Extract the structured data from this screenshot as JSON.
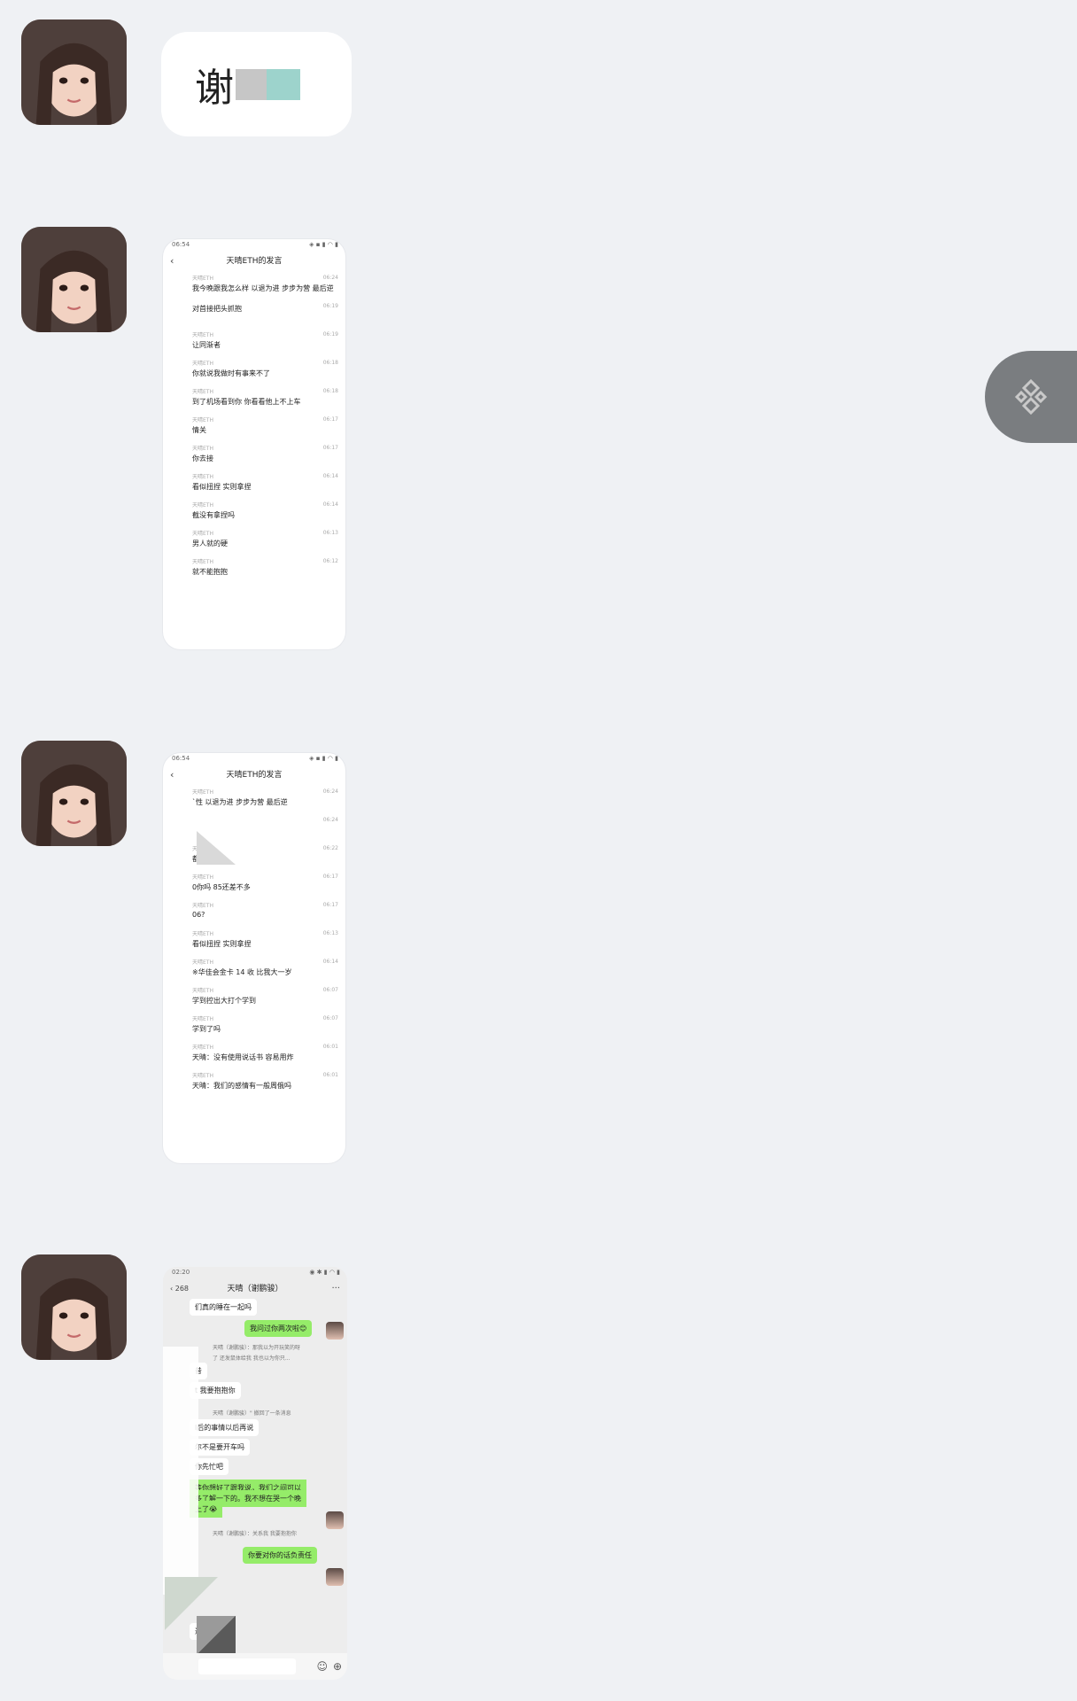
{
  "message1": {
    "text": "谢"
  },
  "float_button": {
    "icon": "binance-logo-icon"
  },
  "screenshot1": {
    "status_time": "06:54",
    "title": "天晴ETH的发言",
    "rows": [
      {
        "name": "天晴ETH",
        "time": "06:24",
        "msg": "我今晚跟我怎么样 以退为进 步步为营 最后逆"
      },
      {
        "name": "",
        "time": "06:19",
        "msg": "对首接把头抓抱"
      },
      {
        "name": "天晴ETH",
        "time": "06:19",
        "msg": "让同渐者"
      },
      {
        "name": "天晴ETH",
        "time": "06:18",
        "msg": "你就说我做时有事来不了"
      },
      {
        "name": "天晴ETH",
        "time": "06:18",
        "msg": "到了机场看到你 你看看他上不上车"
      },
      {
        "name": "天晴ETH",
        "time": "06:17",
        "msg": "情关"
      },
      {
        "name": "天晴ETH",
        "time": "06:17",
        "msg": "你去接"
      },
      {
        "name": "天晴ETH",
        "time": "06:14",
        "msg": "看似扭捏 实则拿捏"
      },
      {
        "name": "天晴ETH",
        "time": "06:14",
        "msg": "截没有拿捏吗"
      },
      {
        "name": "天晴ETH",
        "time": "06:13",
        "msg": "男人就的硬"
      },
      {
        "name": "天晴ETH",
        "time": "06:12",
        "msg": "就不能抱抱"
      }
    ]
  },
  "screenshot2": {
    "status_time": "06:54",
    "title": "天晴ETH的发言",
    "rows": [
      {
        "name": "天晴ETH",
        "time": "06:24",
        "msg": "`性 以退为进 步步为营 最后逆"
      },
      {
        "name": "",
        "time": "06:24",
        "msg": ""
      },
      {
        "name": "天晴ETH",
        "time": "06:22",
        "msg": "都没认识几天"
      },
      {
        "name": "天晴ETH",
        "time": "06:17",
        "msg": "0你吗 85还差不多"
      },
      {
        "name": "天晴ETH",
        "time": "06:17",
        "msg": "06?"
      },
      {
        "name": "天晴ETH",
        "time": "06:13",
        "msg": "看似扭捏 实则拿捏"
      },
      {
        "name": "天晴ETH",
        "time": "06:14",
        "msg": "※华佳会金卡 14 收 比我大一岁"
      },
      {
        "name": "天晴ETH",
        "time": "06:07",
        "msg": "学到控出大打个学到"
      },
      {
        "name": "天晴ETH",
        "time": "06:07",
        "msg": "学到了吗"
      },
      {
        "name": "天晴ETH",
        "time": "06:01",
        "msg": "天晴：没有使用说话书 容易用炸"
      },
      {
        "name": "天晴ETH",
        "time": "06:01",
        "msg": "天晴：我们的感情有一般周俄吗"
      }
    ]
  },
  "screenshot3": {
    "status_time": "02:20",
    "back_count": "268",
    "title": "天晴（谢鹏骏）",
    "more": "···",
    "messages": [
      {
        "side": "l",
        "text": "们真的睡在一起吗"
      },
      {
        "side": "r",
        "text": "我问过你两次啦😊"
      },
      {
        "side": "sys",
        "text": "天晴（谢鹏骏）：那我以为开玩笑的呀"
      },
      {
        "side": "sys",
        "text": "了 还发鼠体给我 我也以为你只..."
      },
      {
        "side": "l",
        "text": "昔"
      },
      {
        "side": "l",
        "text": "t 我要抱抱你"
      },
      {
        "side": "sys",
        "text": "天晴（谢鹏骏）\" 撤回了一条消息"
      },
      {
        "side": "l",
        "text": "l后的事情以后再说"
      },
      {
        "side": "l",
        "text": "尔不是要开车吗"
      },
      {
        "side": "l",
        "text": "你先忙吧"
      },
      {
        "side": "r",
        "text": "等你想好了跟我说，我们之间可以"
      },
      {
        "side": "r",
        "text": "多了解一下的。我不想在哭一个晚"
      },
      {
        "side": "r",
        "text": "上了😭"
      },
      {
        "side": "sys",
        "text": "天晴（谢鹏骏）：关系我 我要抱抱你"
      },
      {
        "side": "r",
        "text": "你要对你的话负责任"
      },
      {
        "side": "l",
        "text": "过来"
      }
    ]
  }
}
